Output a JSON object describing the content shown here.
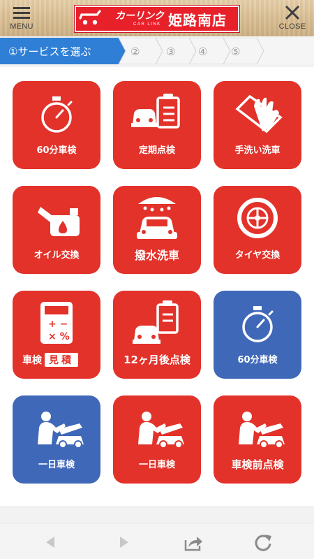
{
  "header": {
    "menu_label": "MENU",
    "close_label": "CLOSE",
    "logo": {
      "brand": "カーリンク",
      "brand_sub": "CAR LINK",
      "branch": "姫路南店"
    }
  },
  "steps": [
    "①サービスを選ぶ",
    "②",
    "③",
    "④",
    "⑤"
  ],
  "tiles": [
    {
      "label": "60分車検",
      "icon": "stopwatch-icon",
      "color": "red"
    },
    {
      "label": "定期点検",
      "icon": "car-checklist-icon",
      "color": "red"
    },
    {
      "label": "手洗い洗車",
      "icon": "washing-glove-icon",
      "color": "red"
    },
    {
      "label": "オイル交換",
      "icon": "oil-can-icon",
      "color": "red"
    },
    {
      "label": "撥水洗車",
      "icon": "car-wash-icon",
      "color": "red"
    },
    {
      "label": "タイヤ交換",
      "icon": "tire-icon",
      "color": "red"
    },
    {
      "label": "車検",
      "badge": "見積",
      "icon": "calculator-icon",
      "color": "red"
    },
    {
      "label": "12ヶ月後点検",
      "icon": "car-checklist-icon",
      "color": "red"
    },
    {
      "label": "60分車検",
      "icon": "stopwatch-icon",
      "color": "blue"
    },
    {
      "label": "一日車検",
      "icon": "mechanic-icon",
      "color": "blue"
    },
    {
      "label": "一日車検",
      "icon": "mechanic-icon",
      "color": "red"
    },
    {
      "label": "車検前点検",
      "icon": "mechanic-icon",
      "color": "red"
    }
  ],
  "colors": {
    "tile_red": "#e2322a",
    "tile_blue": "#3f68b8",
    "step_active": "#2f7fd6",
    "logo_red": "#e8202a"
  },
  "toolbar": [
    "back-arrow-icon",
    "forward-arrow-icon",
    "share-icon",
    "reload-icon"
  ]
}
